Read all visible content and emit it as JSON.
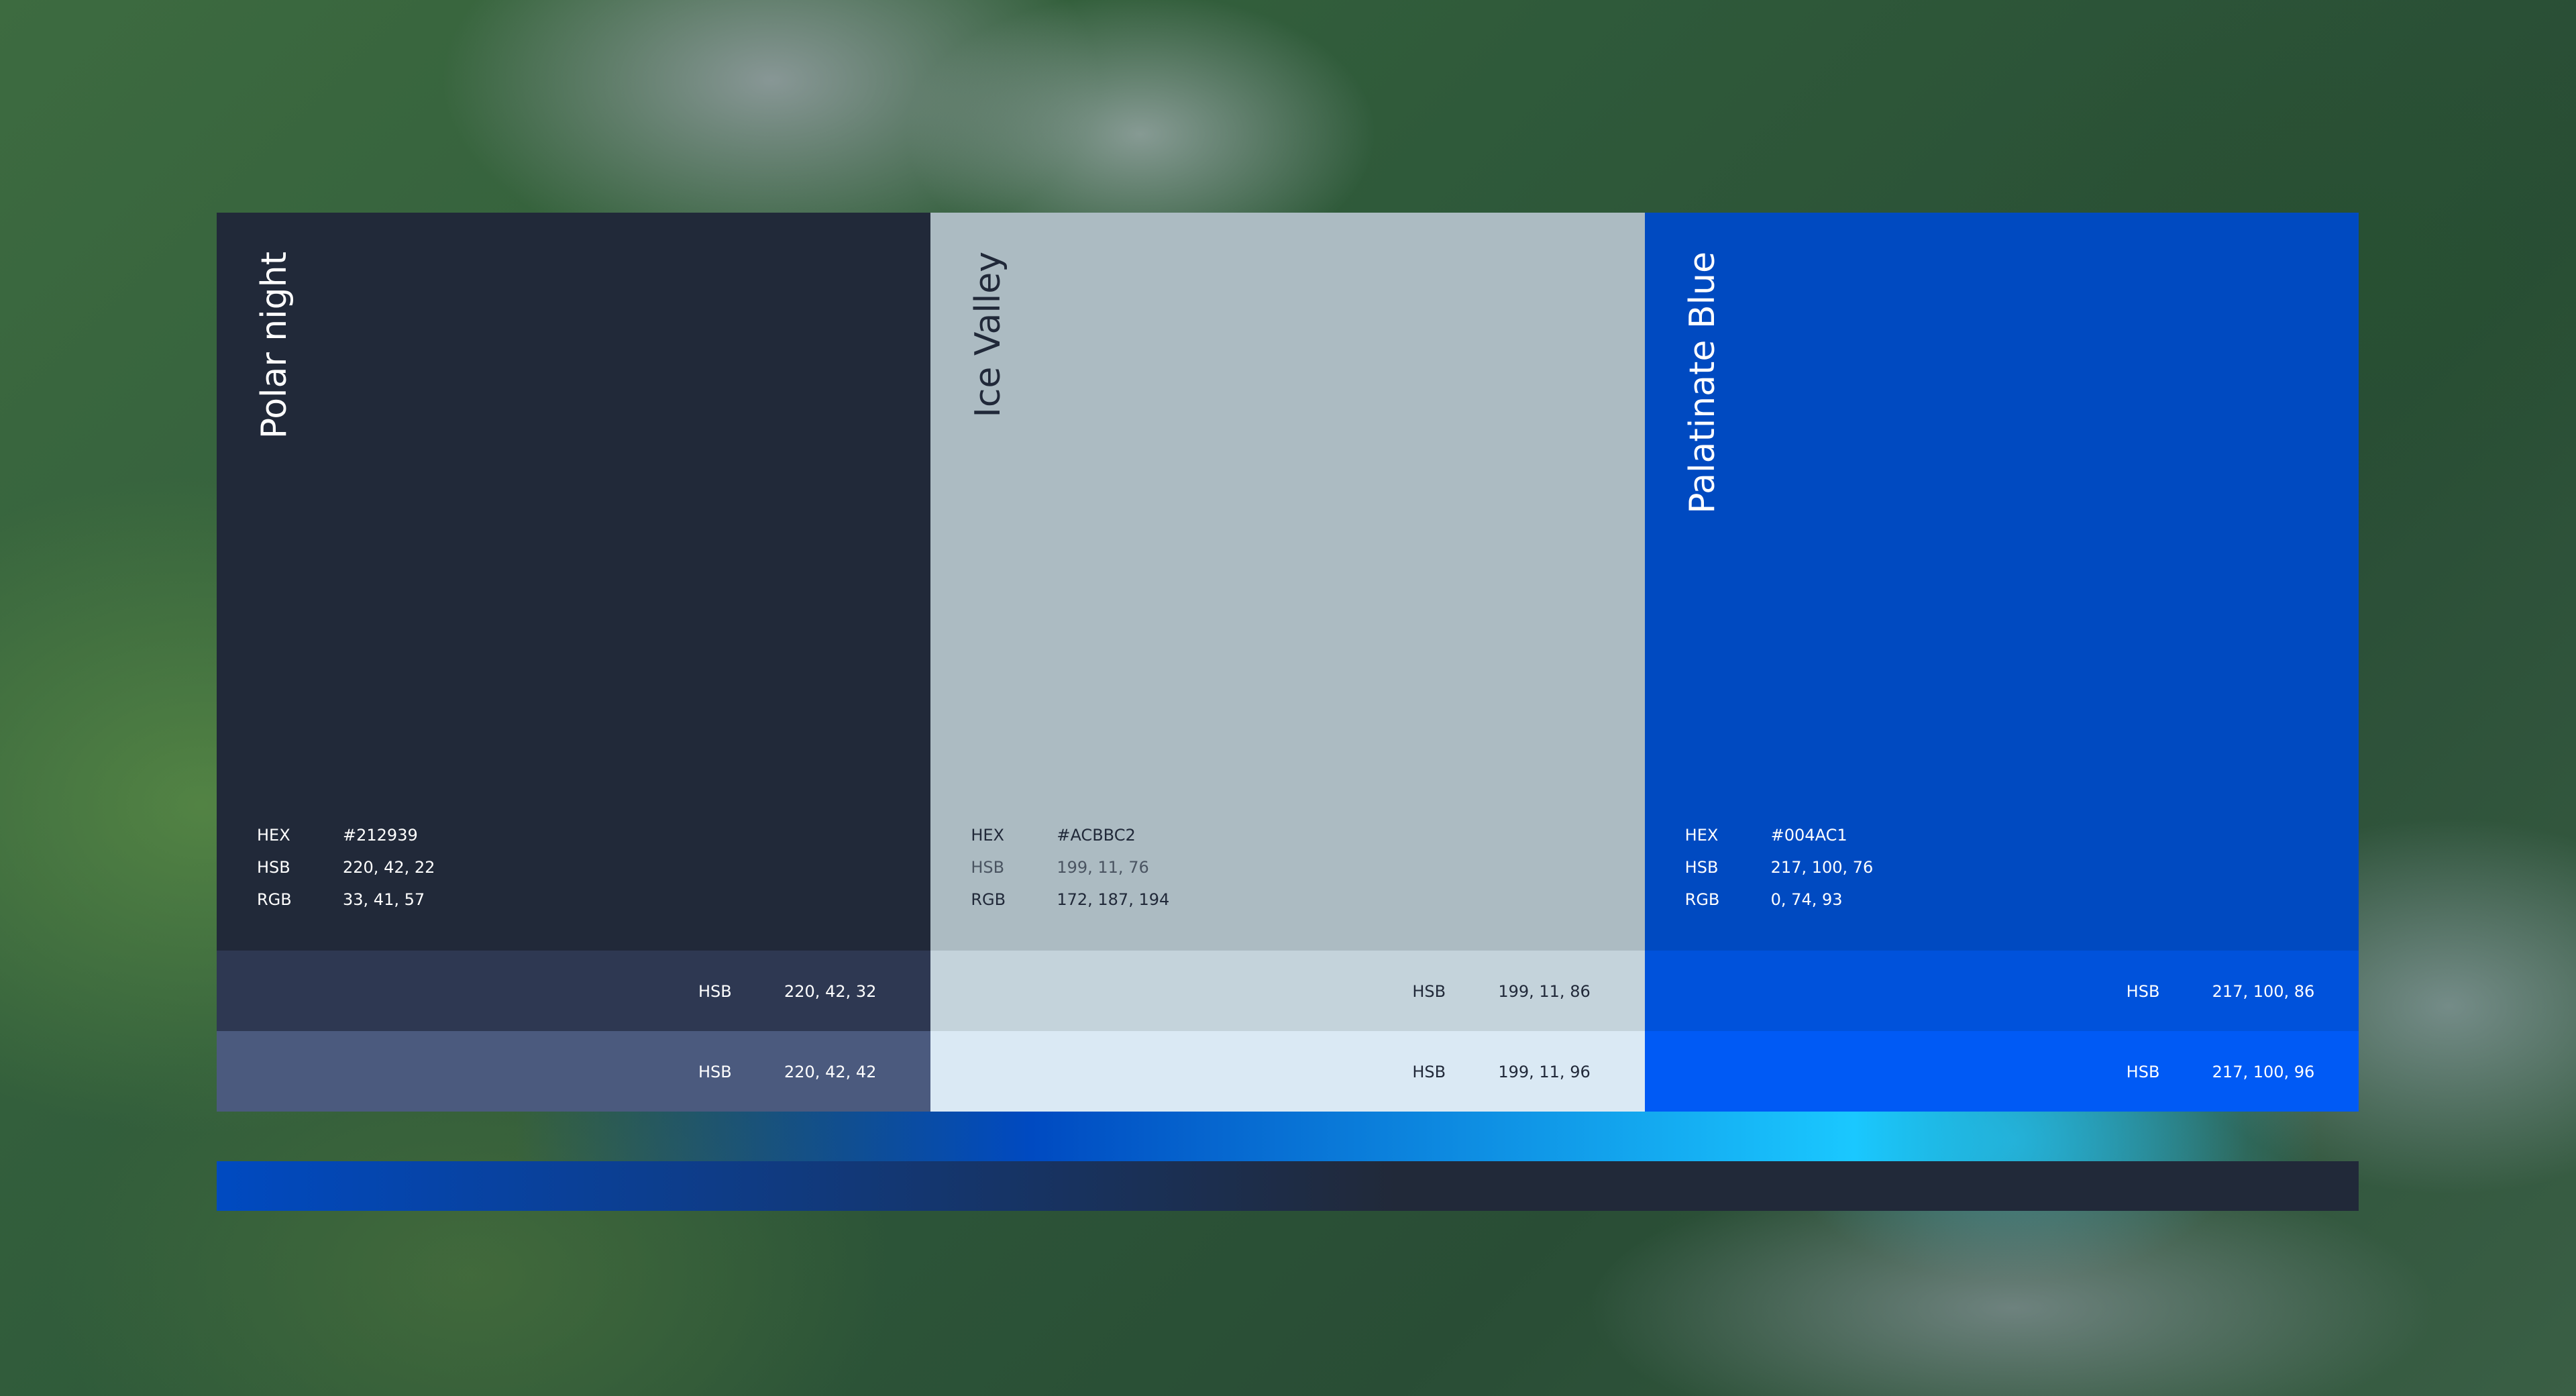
{
  "colors": [
    {
      "name": "Polar night",
      "base_color": "#212939",
      "text_color": "#FFFFFF",
      "hex_label": "HEX",
      "hex": "#212939",
      "hsb_label": "HSB",
      "hsb": "220, 42, 22",
      "rgb_label": "RGB",
      "rgb": "33, 41, 57",
      "shades": [
        {
          "color": "#2E3852",
          "text_color": "#FFFFFF",
          "label": "HSB",
          "value": "220, 42, 32"
        },
        {
          "color": "#4B5A7E",
          "text_color": "#FFFFFF",
          "label": "HSB",
          "value": "220, 42, 42"
        }
      ]
    },
    {
      "name": "Ice Valley",
      "base_color": "#ACBBC2",
      "text_color": "#212939",
      "hex_label": "HEX",
      "hex": "#ACBBC2",
      "hsb_label": "HSB",
      "hsb": "199, 11, 76",
      "rgb_label": "RGB",
      "rgb": "172, 187, 194",
      "shades": [
        {
          "color": "#C4D3DB",
          "text_color": "#212939",
          "label": "HSB",
          "value": "199, 11, 86"
        },
        {
          "color": "#DAE9F4",
          "text_color": "#212939",
          "label": "HSB",
          "value": "199, 11, 96"
        }
      ]
    },
    {
      "name": "Palatinate Blue",
      "base_color": "#004AC1",
      "text_color": "#FFFFFF",
      "hex_label": "HEX",
      "hex": "#004AC1",
      "hsb_label": "HSB",
      "hsb": "217, 100, 76",
      "rgb_label": "RGB",
      "rgb": "0, 74, 93",
      "shades": [
        {
          "color": "#0052DB",
          "text_color": "#FFFFFF",
          "label": "HSB",
          "value": "217, 100, 86"
        },
        {
          "color": "#005AF5",
          "text_color": "#FFFFFF",
          "label": "HSB",
          "value": "217, 100, 96"
        }
      ]
    }
  ],
  "gradients": {
    "top_strip": [
      "#004AC1",
      "#1AC8FF"
    ],
    "bottom_bar": [
      "#004AC1",
      "#212939"
    ]
  }
}
